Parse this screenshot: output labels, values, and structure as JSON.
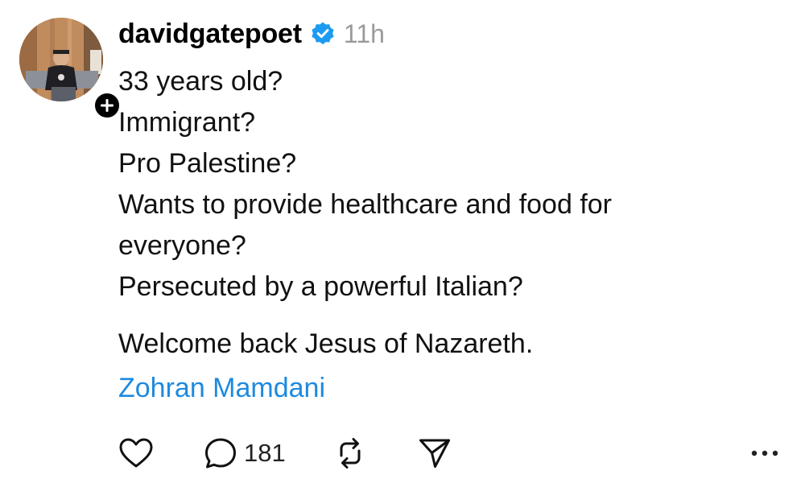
{
  "post": {
    "author": {
      "username": "davidgatepoet",
      "verified": true,
      "avatar_icon": "profile-photo",
      "follow_icon": "plus-icon"
    },
    "timestamp": "11h",
    "lines": [
      "33 years old?",
      "Immigrant?",
      "Pro Palestine?",
      "Wants to provide healthcare and food for",
      "everyone?",
      "Persecuted by a powerful Italian?"
    ],
    "closing_line": "Welcome back Jesus of Nazareth.",
    "mention": "Zohran Mamdani",
    "actions": {
      "like_icon": "heart-icon",
      "reply_icon": "comment-icon",
      "reply_count": "181",
      "repost_icon": "repost-icon",
      "share_icon": "send-icon",
      "more_icon": "more-icon"
    },
    "colors": {
      "verified_badge": "#1d9bf0",
      "mention": "#1d8ae0",
      "timestamp": "#9a9a9a"
    }
  }
}
